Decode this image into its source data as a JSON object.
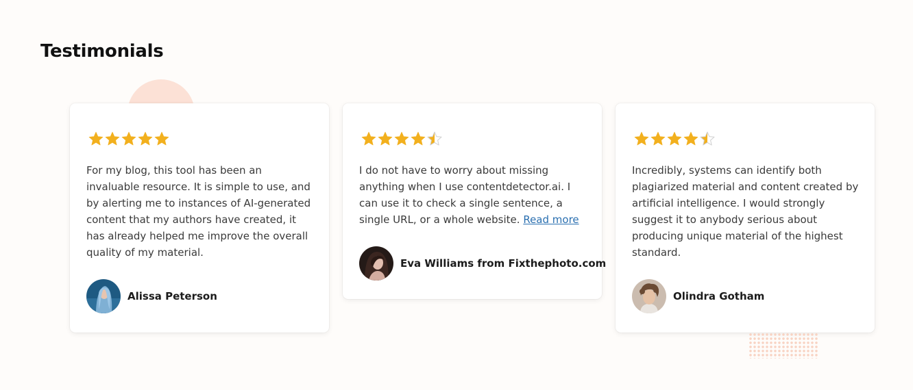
{
  "section": {
    "title": "Testimonials"
  },
  "colors": {
    "star": "#f2b01e",
    "star_empty": "#cfcfcf",
    "link": "#2a6fb0",
    "deco": "#fce1d6"
  },
  "testimonials": [
    {
      "rating": 5,
      "text": "For my blog, this tool has been an invaluable resource. It is simple to use, and by alerting me to instances of AI-generated content that my authors have created, it has already helped me improve the overall quality of my material.",
      "link_text": "",
      "author": "Alissa Peterson",
      "avatar_icon": "avatar-photo-blue-hair"
    },
    {
      "rating": 4.5,
      "text": "I do not have to worry about missing anything when I use contentdetector.ai. I can use it to check a single sentence, a single URL, or a whole website.",
      "link_text": "Read more",
      "author": "Eva Williams from Fixthephoto.com",
      "avatar_icon": "avatar-photo-dark-hair"
    },
    {
      "rating": 4.5,
      "text": "Incredibly, systems can identify both plagiarized material and content created by artificial intelligence. I would strongly suggest it to anybody serious about producing unique material of the highest standard.",
      "link_text": "",
      "author": "Olindra Gotham",
      "avatar_icon": "avatar-photo-curly-hair"
    }
  ]
}
